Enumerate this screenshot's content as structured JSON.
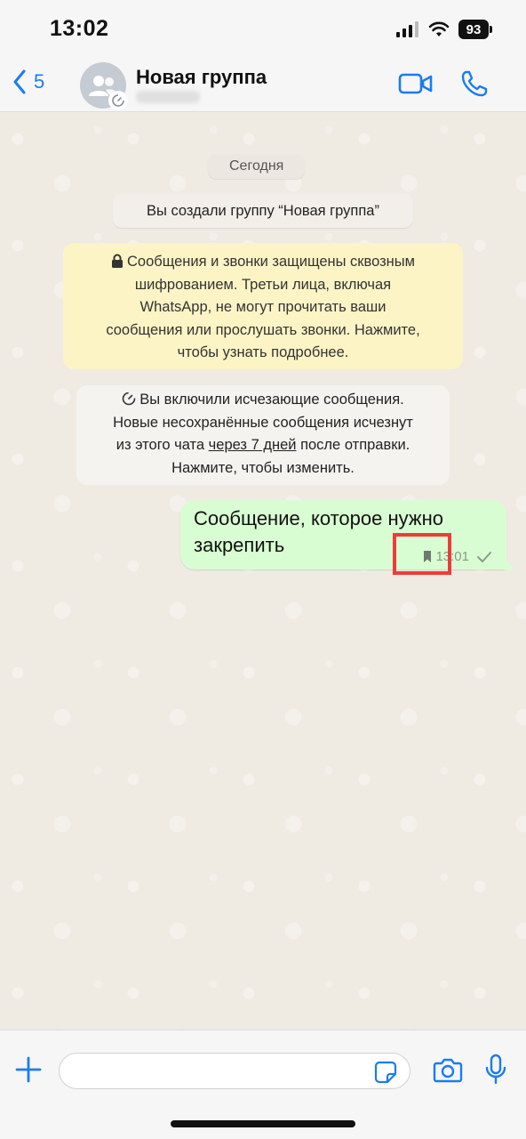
{
  "status_bar": {
    "time": "13:02",
    "battery": "93"
  },
  "header": {
    "back_count": "5",
    "title": "Новая группа"
  },
  "chat": {
    "date": "Сегодня",
    "system_message": "Вы создали группу “Новая группа”",
    "encryption_note": {
      "line1": "Сообщения и звонки защищены сквозным",
      "line2": "шифрованием. Третьи лица, включая",
      "line3": "WhatsApp, не могут прочитать ваши",
      "line4": "сообщения или прослушать звонки. Нажмите,",
      "line5": "чтобы узнать подробнее."
    },
    "disappearing_note": {
      "line1": "Вы включили исчезающие сообщения.",
      "line2": "Новые несохранённые сообщения исчезнут",
      "line3_pre": "из этого чата ",
      "line3_link": "через 7 дней",
      "line3_post": " после отправки.",
      "line4": "Нажмите, чтобы изменить."
    },
    "message": {
      "text": "Сообщение, которое нужно закрепить",
      "time": "13:01"
    }
  },
  "composer": {
    "placeholder": ""
  },
  "colors": {
    "accent": "#1a7cf0",
    "bubble_out": "#d9fdd3",
    "encryption_bg": "#fdf4c5",
    "highlight": "#ef3b3b"
  },
  "icons": {
    "back": "chevron-left-icon",
    "video": "video-camera-icon",
    "call": "phone-icon",
    "lock": "lock-icon",
    "timer": "timer-icon",
    "bookmark": "bookmark-icon",
    "check": "check-icon",
    "plus": "plus-icon",
    "sticker": "sticker-icon",
    "camera": "camera-icon",
    "mic": "microphone-icon"
  }
}
